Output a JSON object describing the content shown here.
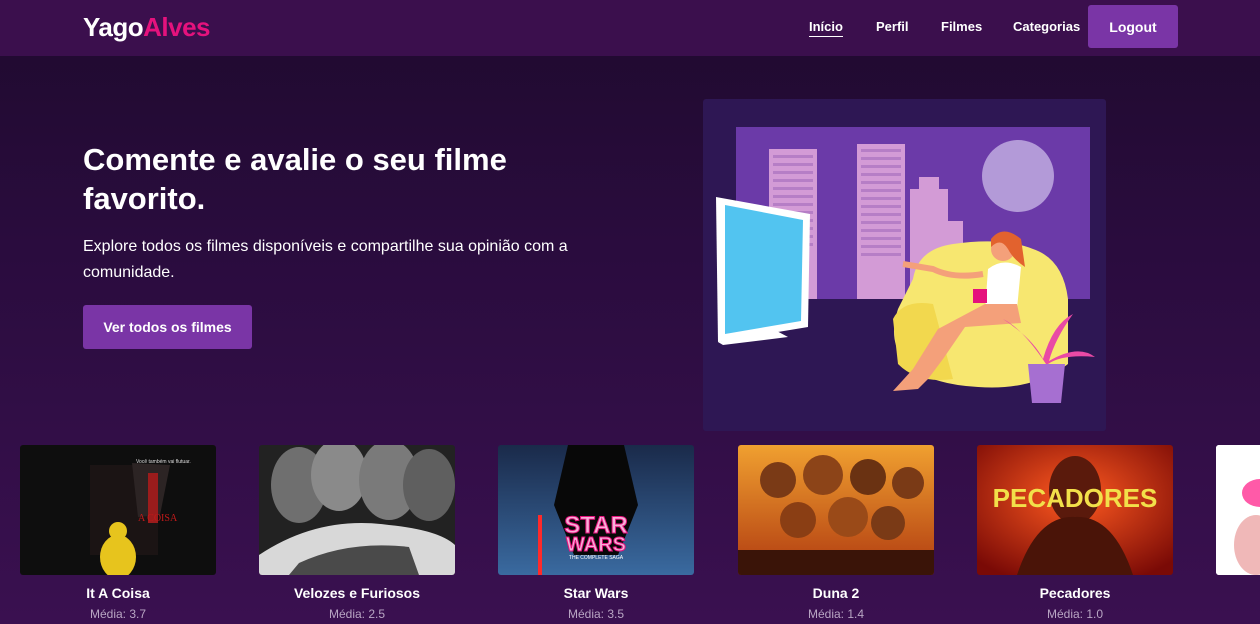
{
  "brand": {
    "first": "Yago",
    "second": "Alves",
    "accent": "#e5127d"
  },
  "nav": {
    "items": [
      "Início",
      "Perfil",
      "Filmes",
      "Categorias"
    ],
    "active_index": 0,
    "logout_label": "Logout"
  },
  "hero": {
    "title": "Comente e avalie o seu filme favorito.",
    "subtitle": "Explore todos os filmes disponíveis e compartilhe sua opinião com a comunidade.",
    "cta_label": "Ver todos os filmes"
  },
  "rating_prefix": "Média:",
  "movies": [
    {
      "title": "It A Coisa",
      "rating": "3.7"
    },
    {
      "title": "Velozes e Furiosos",
      "rating": "2.5"
    },
    {
      "title": "Star Wars",
      "rating": "3.5"
    },
    {
      "title": "Duna 2",
      "rating": "1.4"
    },
    {
      "title": "Pecadores",
      "rating": "1.0"
    }
  ],
  "posters": {
    "it": {
      "tagline": "Você também vai flutuar.",
      "logo": "A COISA"
    },
    "starwars": {
      "line1": "STAR",
      "line2": "WARS",
      "sub": "THE COMPLETE SAGA"
    },
    "pecadores": {
      "logo": "PECADORES"
    }
  },
  "colors": {
    "nav_bg": "#3b0f4d",
    "button": "#7a35a6",
    "page_bg": "#2a0c3e"
  }
}
